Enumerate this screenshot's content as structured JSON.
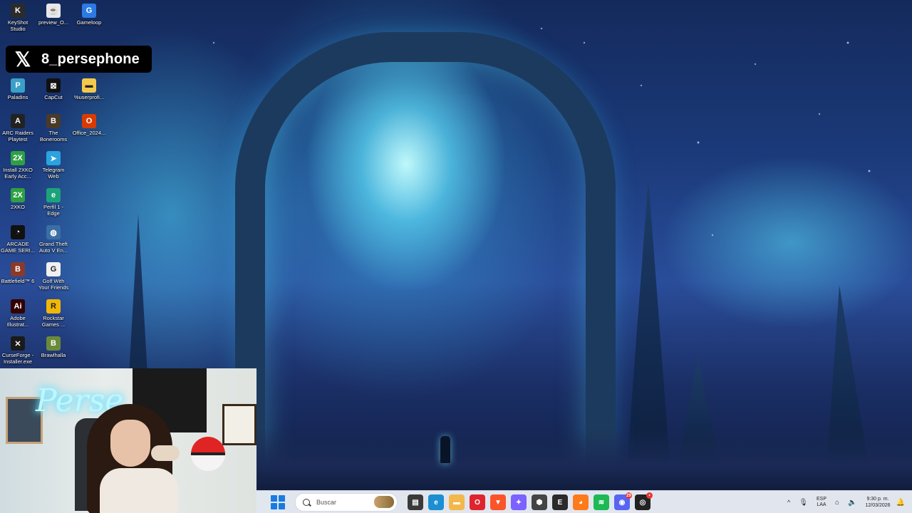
{
  "overlay": {
    "handle": "8_persephone"
  },
  "desktop_icons": [
    {
      "label": "KeyShot\nStudio",
      "icon": "keyshot-icon",
      "color": "#2b2b2b",
      "glyph": "K"
    },
    {
      "label": "preview_O...",
      "icon": "java-file-icon",
      "color": "#e8e8e8",
      "glyph": "☕"
    },
    {
      "label": "Gameloop",
      "icon": "gameloop-icon",
      "color": "#2c7be5",
      "glyph": "G"
    },
    {
      "label": "Paladins",
      "icon": "paladins-icon",
      "color": "#3aa0c8",
      "glyph": "P"
    },
    {
      "label": "CapCut",
      "icon": "capcut-icon",
      "color": "#111111",
      "glyph": "⊠"
    },
    {
      "label": "%userprofi...",
      "icon": "folder-icon",
      "color": "#f2c94c",
      "glyph": "▬"
    },
    {
      "label": "ARC Raiders\nPlaytest",
      "icon": "arc-raiders-icon",
      "color": "#222222",
      "glyph": "A"
    },
    {
      "label": "The\nBonerooms",
      "icon": "bonerooms-icon",
      "color": "#4a3a2a",
      "glyph": "B"
    },
    {
      "label": "Office_2024...",
      "icon": "office-icon",
      "color": "#d83b01",
      "glyph": "O"
    },
    {
      "label": "Install 2XKO\nEarly Acc...",
      "icon": "2xko-installer-icon",
      "color": "#2ea043",
      "glyph": "2X"
    },
    {
      "label": "Telegram\nWeb",
      "icon": "telegram-icon",
      "color": "#2aa3df",
      "glyph": "➤"
    },
    {
      "label": "2XKO",
      "icon": "2xko-icon",
      "color": "#2ea043",
      "glyph": "2X"
    },
    {
      "label": "Perfil 1 -\nEdge",
      "icon": "edge-icon",
      "color": "#1ca37a",
      "glyph": "e"
    },
    {
      "label": "ARCADE\nGAME SERI...",
      "icon": "pacman-icon",
      "color": "#111111",
      "glyph": "◔"
    },
    {
      "label": "Grand Theft\nAuto V En...",
      "icon": "gta-globe-icon",
      "color": "#3a6ea5",
      "glyph": "◍"
    },
    {
      "label": "Battlefield™ 6",
      "icon": "battlefield-icon",
      "color": "#8a3a2a",
      "glyph": "B"
    },
    {
      "label": "Golf With\nYour Friends",
      "icon": "golf-icon",
      "color": "#f0f0f0",
      "glyph": "G"
    },
    {
      "label": "Adobe\nIllustrat...",
      "icon": "illustrator-icon",
      "color": "#330000",
      "glyph": "Ai"
    },
    {
      "label": "Rockstar\nGames ...",
      "icon": "rockstar-icon",
      "color": "#f2b705",
      "glyph": "R"
    },
    {
      "label": "CurseForge -\nInstaller.exe",
      "icon": "curseforge-icon",
      "color": "#1a1a1a",
      "glyph": "✕"
    },
    {
      "label": "Brawlhalla",
      "icon": "brawlhalla-icon",
      "color": "#6a8a3a",
      "glyph": "B"
    }
  ],
  "webcam": {
    "neon_text": "Perse"
  },
  "taskbar": {
    "search_placeholder": "Buscar",
    "apps": [
      {
        "name": "file-explorer-dark-icon",
        "color": "#3a3a3a",
        "glyph": "▤"
      },
      {
        "name": "edge-browser-icon",
        "color": "#1b8fd1",
        "glyph": "e"
      },
      {
        "name": "file-explorer-icon",
        "color": "#f2b84c",
        "glyph": "▬"
      },
      {
        "name": "opera-icon",
        "color": "#e0242f",
        "glyph": "O"
      },
      {
        "name": "brave-icon",
        "color": "#fb542b",
        "glyph": "▼"
      },
      {
        "name": "copilot-icon",
        "color": "#7b61ff",
        "glyph": "✦"
      },
      {
        "name": "3d-app-icon",
        "color": "#444444",
        "glyph": "⬢"
      },
      {
        "name": "epic-games-icon",
        "color": "#2b2b2b",
        "glyph": "E"
      },
      {
        "name": "firefox-icon",
        "color": "#ff7a1a",
        "glyph": "◕"
      },
      {
        "name": "spotify-icon",
        "color": "#1db954",
        "glyph": "≋"
      },
      {
        "name": "discord-icon",
        "color": "#5865f2",
        "glyph": "◉",
        "badge": "29"
      },
      {
        "name": "obs-icon",
        "color": "#222222",
        "glyph": "◎",
        "badge": "•"
      }
    ],
    "tray": {
      "chevron": "^",
      "lang_top": "ESP",
      "lang_bottom": "LAA",
      "time": "9:30 p. m.",
      "date": "12/03/2026"
    }
  }
}
